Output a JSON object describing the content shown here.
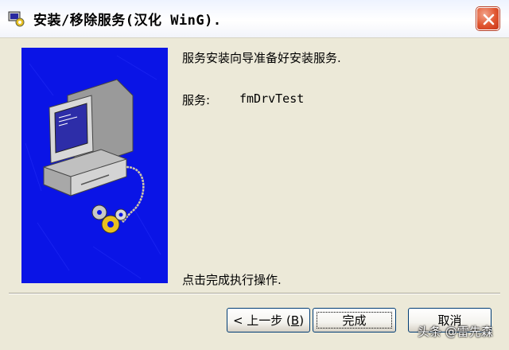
{
  "window": {
    "title": "安装/移除服务(汉化 WinG).",
    "title_icon": "gears-installer-icon",
    "close_icon": "close-x-icon"
  },
  "content": {
    "intro": "服务安装向导准备好安装服务.",
    "service_label": "服务:",
    "service_name": "fmDrvTest",
    "instruction": "点击完成执行操作."
  },
  "buttons": {
    "back_prefix": "< 上一步 (",
    "back_key": "B",
    "back_suffix": ")",
    "finish": "完成",
    "cancel": "取消"
  },
  "watermark": "头条 @雷先森",
  "colors": {
    "illustration_bg": "#0A14E6",
    "dialog_bg": "#ECE9D8",
    "close_button": "#E0552F"
  }
}
